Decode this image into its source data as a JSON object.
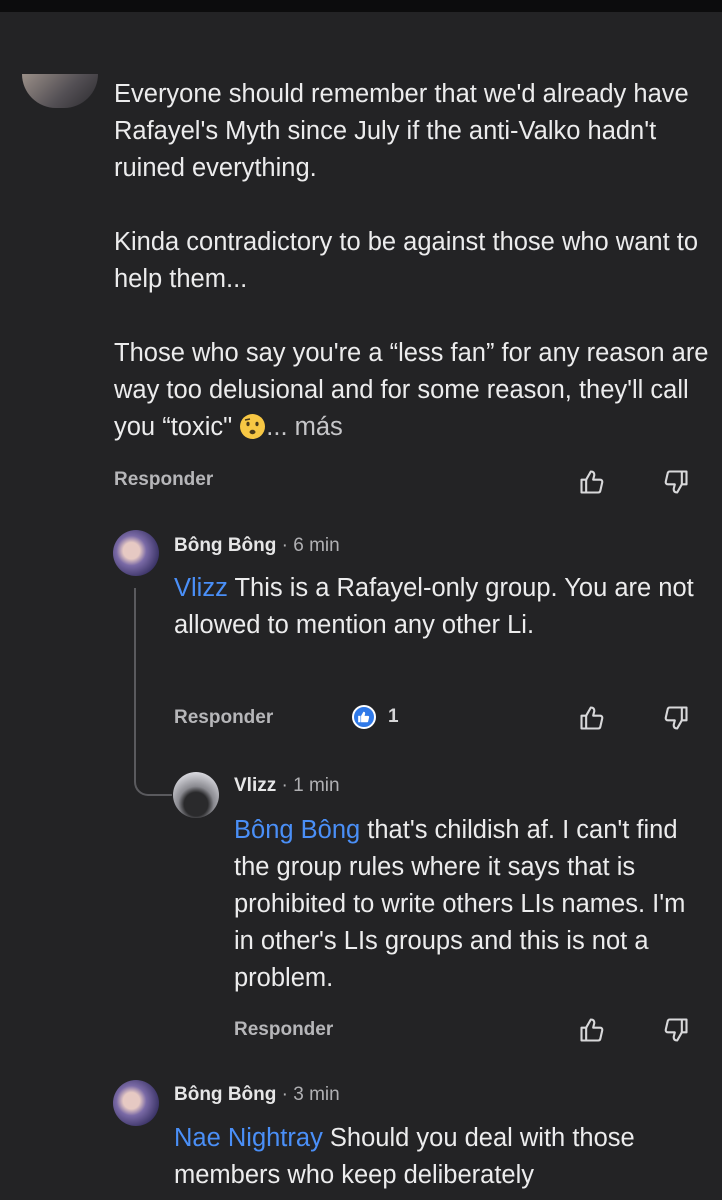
{
  "comments": [
    {
      "author": "",
      "paragraphs": [
        "Everyone should remember that we'd already have Rafayel's Myth since July if the anti-Valko hadn't ruined everything.",
        "Kinda contradictory to be against those who want to help them...",
        "Those who say you're a “less fan” for any reason are way too delusional and for some reason, they'll call you “toxic\""
      ],
      "more_label": "... más",
      "reply_label": "Responder"
    },
    {
      "author": "Bông Bông",
      "time": " · 6 min",
      "mention": "Vlizz",
      "text": " This is a Rafayel-only group. You are not allowed to mention any other Li.",
      "reply_label": "Responder",
      "reaction_count": "1"
    },
    {
      "author": "Vlizz",
      "time": " · 1 min",
      "mention": "Bông Bông",
      "text": " that's childish af. I can't find the group rules where it says that is prohibited to write others LIs names. I'm in other's LIs groups and this is not a problem.",
      "reply_label": "Responder"
    },
    {
      "author": "Bông Bông",
      "time": " · 3 min",
      "mention": "Nae Nightray",
      "text": " Should you deal with those members who keep deliberately"
    }
  ],
  "icons": [
    "thumbs-up-icon",
    "thumbs-down-icon",
    "like-reaction-icon",
    "emoji-icon"
  ],
  "colors": {
    "background": "#232325",
    "mention": "#4a8ff7",
    "reaction": "#2f79e8"
  }
}
